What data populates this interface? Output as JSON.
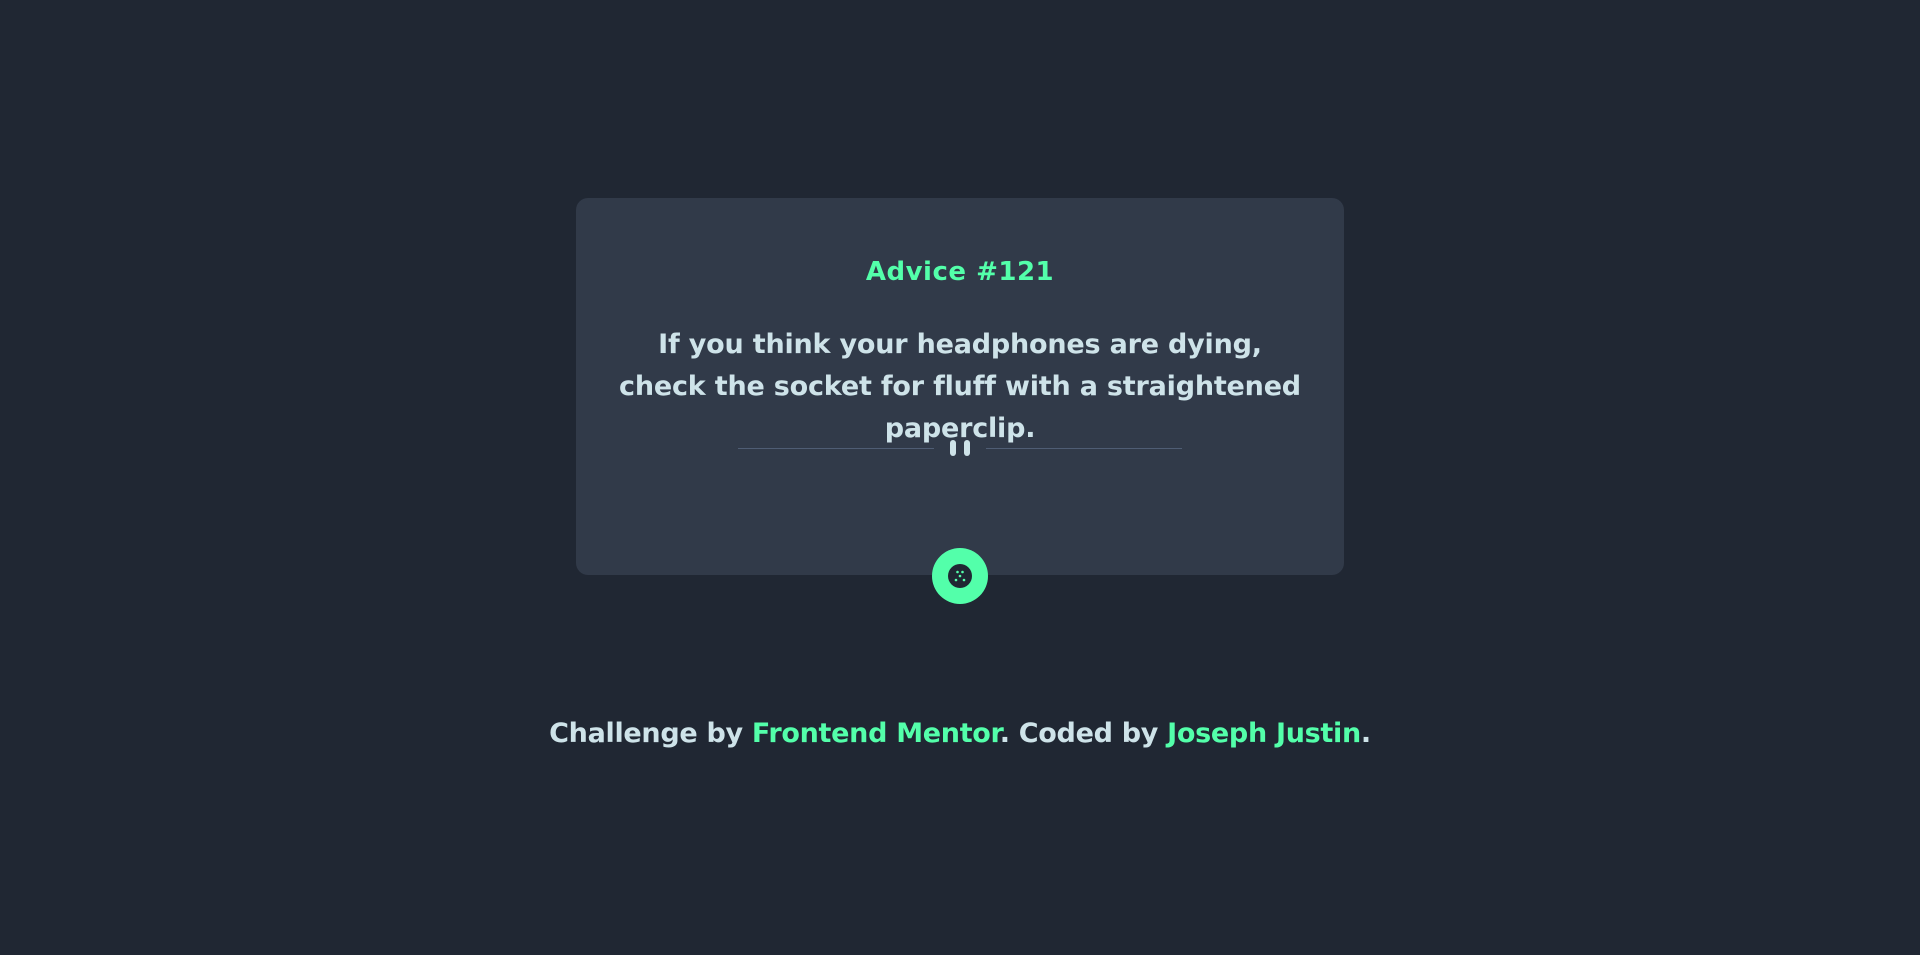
{
  "card": {
    "title": "Advice #121",
    "advice": "If you think your headphones are dying, check the socket for fluff with a straightened paperclip."
  },
  "dice_button": {
    "icon": "dice-icon"
  },
  "divider": {
    "icon": "pause-icon"
  },
  "footer": {
    "prefix": "Challenge by ",
    "challenge_link": "Frontend Mentor",
    "middle": ". Coded by ",
    "author_link": "Joseph Justin",
    "suffix": "."
  },
  "colors": {
    "background": "#202733",
    "card": "#313a49",
    "accent": "#53ffaa",
    "text": "#cee3e9",
    "divider": "#4f5d74"
  }
}
